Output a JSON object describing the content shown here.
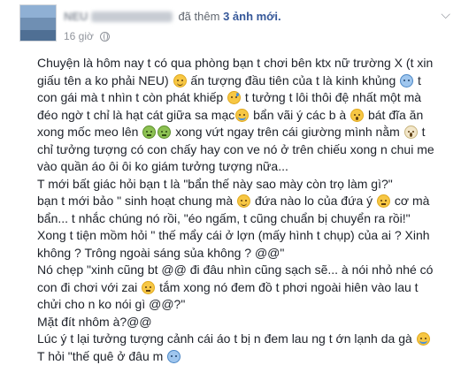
{
  "post": {
    "author": "NEU",
    "action_prefix": "đã thêm",
    "action_highlight": "3 ảnh mới.",
    "timestamp": "16 giờ",
    "privacy_icon": "globe-icon",
    "menu_icon": "chevron-down-icon"
  },
  "body": {
    "p1": {
      "t1": "Chuyện là hôm nay t có qua phòng bạn t chơi bên ktx nữ trường X (t xin giấu tên a ko phải NEU)",
      "t2": "ấn tượng đầu tiên của t là kinh khủng",
      "t3": "t con gái mà t nhìn t còn phát khiếp",
      "t4": "t tưởng t lôi thôi đệ nhất một mà đéo ngờ t chỉ là hạt cát giữa sa mạc",
      "t5": "bẩn vãi ý các b à",
      "t6": "bát đĩa ăn xong mốc meo lên",
      "t7": "xong vứt ngay trên cái giường mình nằm",
      "t8": "t chỉ tưởng tượng có con chấy hay con ve nó ở trên chiếu xong n chui me vào quần áo ôi ôi ko giám tưởng tượng nữa..."
    },
    "p2": "T mới bất giác hỏi bạn t là \"bẩn thế này sao mày còn trọ làm gì?\"",
    "p3": {
      "t1": "bạn t mới bảo \" sinh hoạt chung mà",
      "t2": "đứa nào lo của đứa ý",
      "t3": "cơ mà bẩn... t nhắc chúng nó rồi, \"éo ngấm, t cũng chuẩn bị chuyển ra rồi!\""
    },
    "p4": "Xong t tiện mồm hỏi \" thế mẩy cái ở lợn (mấy hình t chụp) của ai ? Xinh không ? Trông ngoài sáng sủa không ? @@\"",
    "p5": {
      "t1": "Nó chẹp \"xinh cũng bt @@ đi đâu nhìn cũng sạch sẽ... à nói nhỏ nhé có con đi chơi với zai",
      "t2": "tắm xong nó đem đồ t phơi ngoài hiên vào lau t chửi cho n ko nói gì @@?\""
    },
    "p6": "Mặt đít nhôm à?@@",
    "p7": "Lúc ý t lại tưởng tượng cảnh cái áo t bị n đem lau ng t ớn lạnh da gà",
    "p8": "T hỏi \"thế quê ở đâu m"
  },
  "emoticons": [
    "grin-icon",
    "cold-sweat-icon",
    "sweat-icon",
    "crying-icon",
    "shocked-icon",
    "sick-icon",
    "sick-icon",
    "scream-icon",
    "smile-icon",
    "pout-icon",
    "pout-icon",
    "crying-icon",
    "cold-sweat-icon"
  ]
}
